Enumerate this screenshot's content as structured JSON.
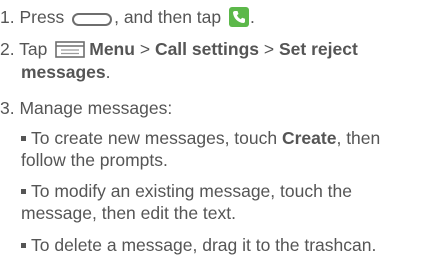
{
  "steps": [
    {
      "number": "1.",
      "text_before": "Press",
      "text_middle": ", and then tap",
      "text_after": "."
    },
    {
      "number": "2.",
      "tap": "Tap",
      "menu_label": "Menu",
      "sep1": ">",
      "call_settings": "Call settings",
      "sep2": ">",
      "set_reject_line1": "Set reject",
      "set_reject_line2": "messages",
      "period": "."
    },
    {
      "number": "3.",
      "text": "Manage messages:"
    }
  ],
  "bullets": [
    {
      "line1_before": "To create new messages, touch",
      "line1_bold": "Create",
      "line1_after": ", then",
      "line2": "follow the prompts."
    },
    {
      "line1": "To modify an existing message, touch the",
      "line2": "message, then edit the text."
    },
    {
      "line1": "To delete a message, drag it to the trashcan."
    }
  ],
  "icons": {
    "home": "home-key-icon",
    "phone": "phone-app-icon",
    "menu": "menu-key-icon"
  },
  "colors": {
    "text": "#555555",
    "phone_green": "#5cb84a"
  }
}
